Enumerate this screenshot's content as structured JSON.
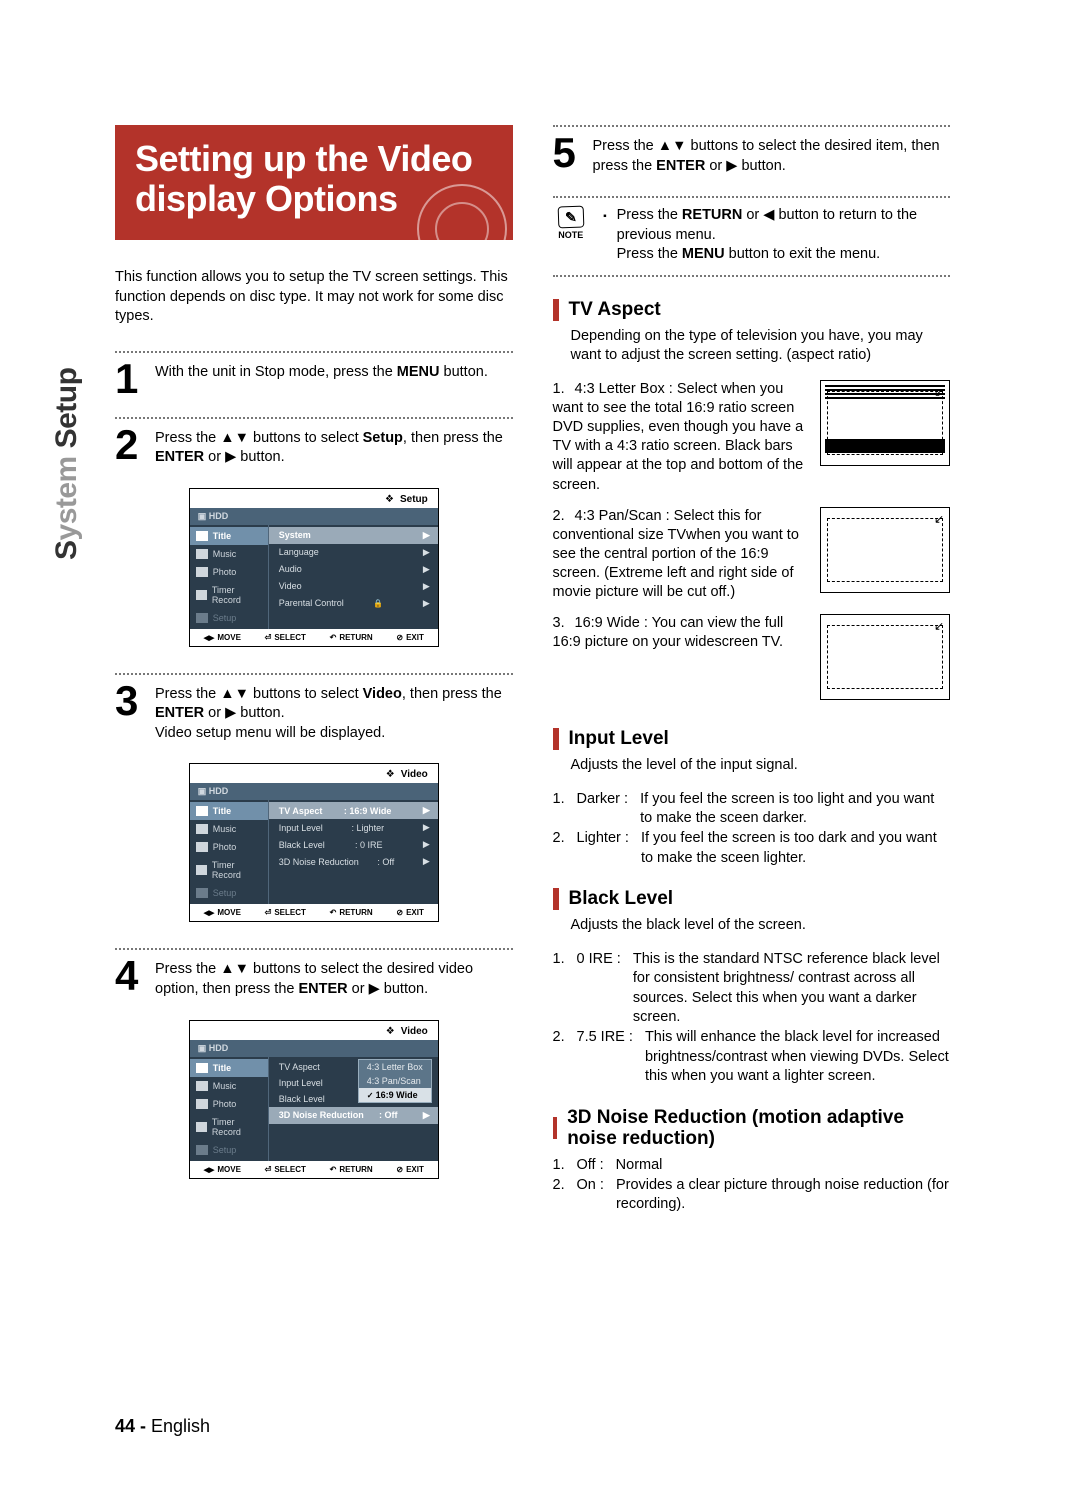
{
  "sectionLabel": {
    "light": "ystem ",
    "dark": "S",
    "suffix": "Setup"
  },
  "title": "Setting up the Video display Options",
  "intro": "This function allows you to setup the TV screen settings. This function depends on disc type. It may not work for some disc types.",
  "steps": {
    "s1": {
      "num": "1",
      "text_a": "With the unit in Stop mode, press the ",
      "menu": "MENU",
      "text_b": " button."
    },
    "s2": {
      "num": "2",
      "text_a": "Press the ▲▼ buttons to select ",
      "setup": "Setup",
      "text_b": ", then press the ",
      "enter": "ENTER",
      "text_c": " or ▶ button."
    },
    "s3": {
      "num": "3",
      "text_a": "Press the ▲▼ buttons to select ",
      "video": "Video",
      "text_b": ", then press the ",
      "enter": "ENTER",
      "text_c": " or ▶ button.",
      "text_d": "Video setup menu will be displayed."
    },
    "s4": {
      "num": "4",
      "text_a": "Press the ▲▼ buttons to select the desired video option, then press the ",
      "enter": "ENTER",
      "text_b": " or ▶ button."
    },
    "s5": {
      "num": "5",
      "text_a": "Press the ▲▼ buttons to select the desired item, then press the ",
      "enter": "ENTER",
      "text_b": " or ▶ button."
    }
  },
  "osd": {
    "hdd": "HDD",
    "side": [
      "Title",
      "Music",
      "Photo",
      "Timer Record",
      "Setup"
    ],
    "top_setup": "Setup",
    "top_video": "Video",
    "menu1": [
      "System",
      "Language",
      "Audio",
      "Video",
      "Parental Control"
    ],
    "menu2": {
      "rows": [
        {
          "l": "TV Aspect",
          "v": ": 16:9 Wide"
        },
        {
          "l": "Input Level",
          "v": ": Lighter"
        },
        {
          "l": "Black Level",
          "v": ": 0 IRE"
        },
        {
          "l": "3D Noise Reduction",
          "v": ": Off"
        }
      ]
    },
    "menu3_opts": [
      "4:3 Letter Box",
      "4:3 Pan/Scan",
      "16:9 Wide"
    ],
    "foot": {
      "move": "MOVE",
      "select": "SELECT",
      "return": "RETURN",
      "exit": "EXIT"
    }
  },
  "note": {
    "label": "NOTE",
    "line1_a": "Press the ",
    "return": "RETURN",
    "line1_b": " or ◀ button to return to the previous menu.",
    "line2_a": "Press the ",
    "menu": "MENU",
    "line2_b": " button to exit the menu."
  },
  "tvAspect": {
    "h": "TV Aspect",
    "desc": "Depending on the type of television you have, you may want to adjust the screen setting. (aspect ratio)",
    "opts": [
      "4:3 Letter  Box : Select when you want to see the total 16:9 ratio screen DVD supplies, even though you have a TV with a 4:3 ratio screen. Black bars will appear at the top and bottom of the screen.",
      "4:3 Pan/Scan : Select this for conventional size TVwhen you want to see the central portion of the 16:9 screen. (Extreme left and right side of movie picture will be cut off.)",
      "16:9 Wide : You can view the full 16:9 picture on your widescreen TV."
    ]
  },
  "inputLevel": {
    "h": "Input Level",
    "desc": "Adjusts the level of the input signal.",
    "opts": [
      {
        "n": "1.",
        "label": "Darker :",
        "t": "If you feel the screen is too light and you want to make the sceen darker."
      },
      {
        "n": "2.",
        "label": "Lighter :",
        "t": "If you feel the screen is too dark and you want to make the sceen lighter."
      }
    ]
  },
  "blackLevel": {
    "h": "Black Level",
    "desc": "Adjusts the black level of the screen.",
    "opts": [
      {
        "n": "1.",
        "label": "0 IRE :",
        "t": "This is the standard NTSC reference black level for consistent brightness/ contrast across all sources. Select this when you want a darker screen."
      },
      {
        "n": "2.",
        "label": "7.5 IRE :",
        "t": "This will  enhance the black level for increased brightness/contrast when viewing DVDs. Select this when you want a lighter screen."
      }
    ]
  },
  "noise": {
    "h": "3D Noise Reduction (motion adaptive noise reduction)",
    "opts": [
      {
        "n": "1.",
        "label": "Off :",
        "t": "Normal"
      },
      {
        "n": "2.",
        "label": "On :",
        "t": "Provides a clear picture through noise reduction (for recording)."
      }
    ]
  },
  "pageNum": {
    "num": "44 -",
    "lang": " English"
  }
}
